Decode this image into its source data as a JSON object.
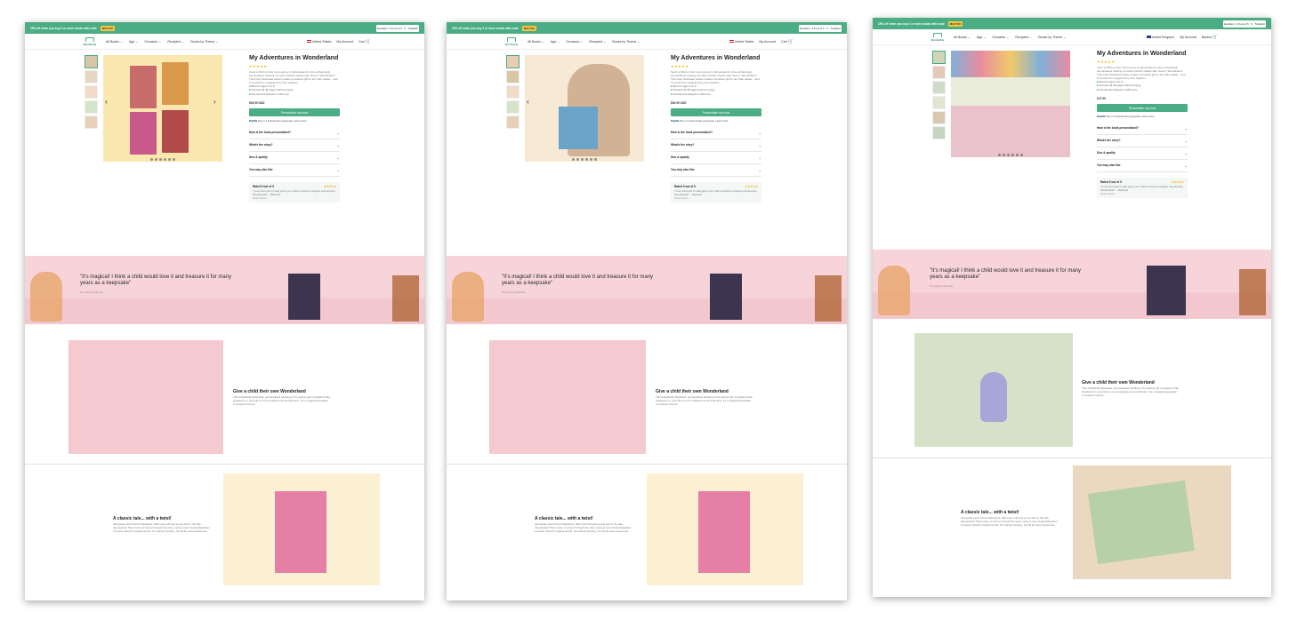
{
  "banner": {
    "promo": "15% off when you buy 2 or more books with code",
    "code": "MULTI15",
    "trustpilot_score": "Excellent",
    "trustpilot_meta": "4.8 out of 5",
    "trustpilot_label": "Trustpilot"
  },
  "nav": {
    "logo": "Wonderbly",
    "items_a": [
      "All Books ⌄",
      "Age ⌄",
      "Occasion ⌄",
      "Recipient ⌄",
      "Books by Theme ⌄"
    ],
    "items_b": [
      "All Books ⌄",
      "Age ⌄",
      "Occasion ⌄",
      "Recipient ⌄",
      "Books by Theme ⌄"
    ],
    "region_us": "United States",
    "region_uk": "United Kingdom",
    "account": "My Account",
    "cart": "Cart",
    "basket": "Basket"
  },
  "product": {
    "title": "My Adventures in Wonderland",
    "stars": "★★★★★",
    "description": "Send a child on their own journey to Wonderland in this enchantingly personalised retelling of Lewis Carroll's classic tale. New in 'Wonderland.' This richly illustrated edition makes a timeless gift for any little reader – and it's perfect for magical story time together.",
    "bullets": [
      "Best for ages 3 to 8",
      "Preview all 48 pages before buying",
      "Printed and shipped in 48 hours"
    ],
    "price_us": "$39.99 USD",
    "price_uk": "£27.99",
    "cta": "Personalise my book",
    "paypal_brand": "PayPal",
    "paypal_text": "Pay in 4 interest-free payments. Learn more",
    "faq": [
      "How is the book personalised?",
      "What's the story?",
      "Size & quality",
      "You may also like"
    ],
    "review_title": "Rated 5 out of 5",
    "review_stars": "★★★★★",
    "review_text": "\"I love this book! It really gives your child a chance to imagine experiencing Wonderland!\" – Rebecca",
    "review_link": "Read reviews"
  },
  "quote": {
    "text": "\"It's magical! I think a child would love it and treasure it for many years as a keepsake\"",
    "by": "Loved by Parents"
  },
  "section_gift": {
    "title": "Give a child their own Wonderland",
    "body": "This delightfully illustrated, personalised retelling is the perfect gift to delight a little bookworm in your life (or more relatives as an heirloom). It's a magical keepsake to treasure forever."
  },
  "section_tale": {
    "title": "A classic tale... with a twist!",
    "body": "Alongside much-loved characters, little ones will spot a new star in the tale... themselves! Their name is woven through the story, using a new visual adaptation of Lewis Carroll's original words. It's entirely bookery, but all the best stories are."
  },
  "colors": {
    "brand_green": "#4aad84",
    "pink": "#f7d4da",
    "star": "#f5b400"
  },
  "icons": [
    "chevron-left-icon",
    "chevron-right-icon",
    "chevron-down-icon",
    "cart-icon",
    "heart-icon",
    "check-icon"
  ]
}
